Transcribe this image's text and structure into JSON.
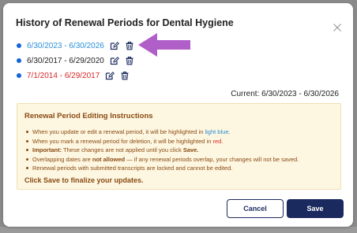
{
  "modal": {
    "title": "History of Renewal Periods for Dental Hygiene",
    "close_icon": "close-icon"
  },
  "periods": [
    {
      "label": "6/30/2023 - 6/30/2026",
      "state": "edited",
      "color": "#2a8fd6"
    },
    {
      "label": "6/30/2017 - 6/29/2020",
      "state": "normal",
      "color": "#222222"
    },
    {
      "label": "7/1/2014 - 6/29/2017",
      "state": "deleted",
      "color": "#d62828"
    }
  ],
  "icons": {
    "edit": "edit-icon",
    "delete": "trash-icon",
    "bullet_color": "#1565d8",
    "arrow_color": "#b05fc8"
  },
  "current": "Current: 6/30/2023 - 6/30/2026",
  "instructions": {
    "title": "Renewal Period Editing Instructions",
    "item1_a": "When you update or edit a renewal period, it will be highlighted in ",
    "item1_b": "light blue",
    "item1_c": ".",
    "item2_a": "When you mark a renewal period for deletion, it will be highlighted in ",
    "item2_b": "red",
    "item2_c": ".",
    "item3_a": "Important:",
    "item3_b": " These changes are not applied until you click ",
    "item3_c": "Save.",
    "item4_a": "Overlapping dates are ",
    "item4_b": "not allowed",
    "item4_c": " — if any renewal periods overlap, your changes will not be saved.",
    "item5": "Renewal periods with submitted transcripts are locked and cannot be edited.",
    "footer": "Click Save to finalize your updates.",
    "bg_color": "#fdf6e1",
    "text_color": "#8a4b12"
  },
  "buttons": {
    "cancel": "Cancel",
    "save": "Save",
    "primary_color": "#1b2a5e"
  }
}
